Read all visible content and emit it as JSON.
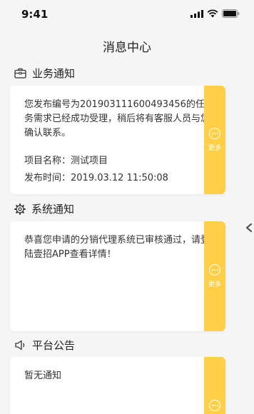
{
  "status_bar": {
    "time": "9:41"
  },
  "page": {
    "title": "消息中心"
  },
  "sections": [
    {
      "title": "业务通知",
      "icon": "briefcase-icon",
      "card": {
        "text": "您发布编号为20190311160049345​6的任务需求已经成功受理，稍后将有客服人员与您确认联系。",
        "project_label": "项目名称：测试项目",
        "publish_time": "发布时间：2019.03.12 11:50:08",
        "more_label": "更多"
      }
    },
    {
      "title": "系统通知",
      "icon": "gear-icon",
      "card": {
        "text": "恭喜您申请的分销代理系统已审核通过，请登陆壹招APP查看详情！",
        "more_label": "更多"
      }
    },
    {
      "title": "平台公告",
      "icon": "megaphone-icon",
      "card": {
        "text": "暂无通知",
        "more_label": "更多"
      }
    }
  ],
  "colors": {
    "accent": "#ffcf48",
    "background": "#f5f5f5",
    "card": "#ffffff"
  }
}
